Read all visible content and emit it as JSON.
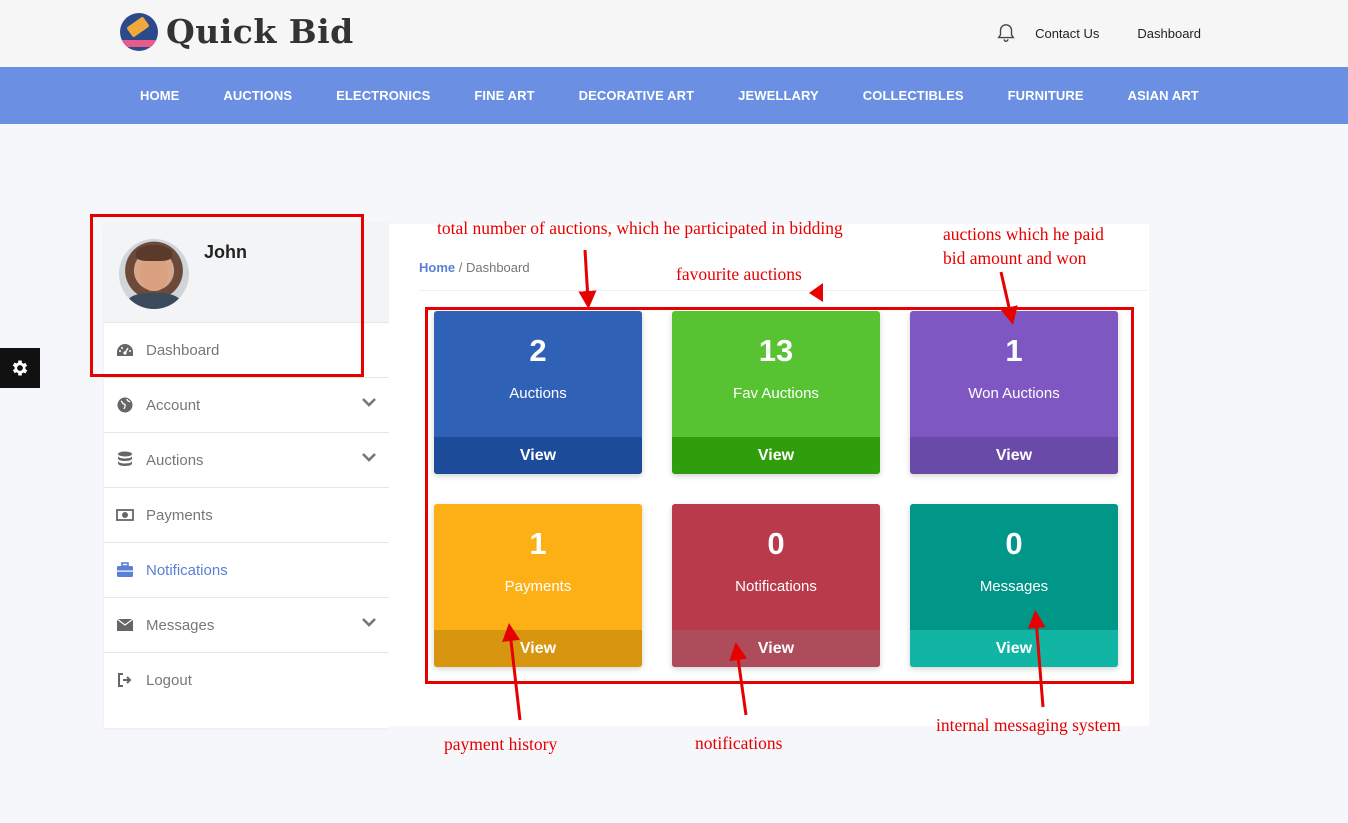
{
  "header": {
    "brand": "Quick Bid",
    "links": [
      "Contact Us",
      "Dashboard"
    ],
    "icons": {
      "notification": "bell-icon",
      "logo": "gavel-logo-icon"
    }
  },
  "nav": {
    "items": [
      "HOME",
      "AUCTIONS",
      "ELECTRONICS",
      "FINE ART",
      "DECORATIVE ART",
      "JEWELLARY",
      "COLLECTIBLES",
      "FURNITURE",
      "ASIAN ART"
    ],
    "bg_color": "#6a8fe3"
  },
  "sidebar": {
    "user_name": "John",
    "items": [
      {
        "label": "Dashboard",
        "icon": "dashboard-gauge-icon",
        "has_chevron": false
      },
      {
        "label": "Account",
        "icon": "globe-icon",
        "has_chevron": true
      },
      {
        "label": "Auctions",
        "icon": "database-icon",
        "has_chevron": true
      },
      {
        "label": "Payments",
        "icon": "money-icon",
        "has_chevron": false
      },
      {
        "label": "Notifications",
        "icon": "briefcase-icon",
        "has_chevron": false,
        "active": true
      },
      {
        "label": "Messages",
        "icon": "envelope-icon",
        "has_chevron": true
      },
      {
        "label": "Logout",
        "icon": "sign-out-icon",
        "has_chevron": false
      }
    ]
  },
  "breadcrumb": {
    "home": "Home",
    "current": "/ Dashboard"
  },
  "cards": [
    {
      "value": "2",
      "label": "Auctions",
      "action": "View",
      "color": "#2f62b6",
      "footer_color": "#1c4b9a"
    },
    {
      "value": "13",
      "label": "Fav Auctions",
      "action": "View",
      "color": "#58c332",
      "footer_color": "#2f9d0c"
    },
    {
      "value": "1",
      "label": "Won Auctions",
      "action": "View",
      "color": "#7e57c2",
      "footer_color": "#6a4aa8"
    },
    {
      "value": "1",
      "label": "Payments",
      "action": "View",
      "color": "#fcb016",
      "footer_color": "#d8950f"
    },
    {
      "value": "0",
      "label": "Notifications",
      "action": "View",
      "color": "#b93a4b",
      "footer_color": "#ad4c5a"
    },
    {
      "value": "0",
      "label": "Messages",
      "action": "View",
      "color": "#009688",
      "footer_color": "#12b5a3"
    }
  ],
  "annotations": {
    "auctions": "total number of auctions, which he participated in bidding",
    "favourites": "favourite auctions",
    "won_line1": "auctions which he paid",
    "won_line2": "bid amount and won",
    "payments": "payment history",
    "notifications": "notifications",
    "messages": "internal messaging system",
    "color": "#e60000"
  },
  "settings_tab": {
    "icon": "gear-icon"
  }
}
